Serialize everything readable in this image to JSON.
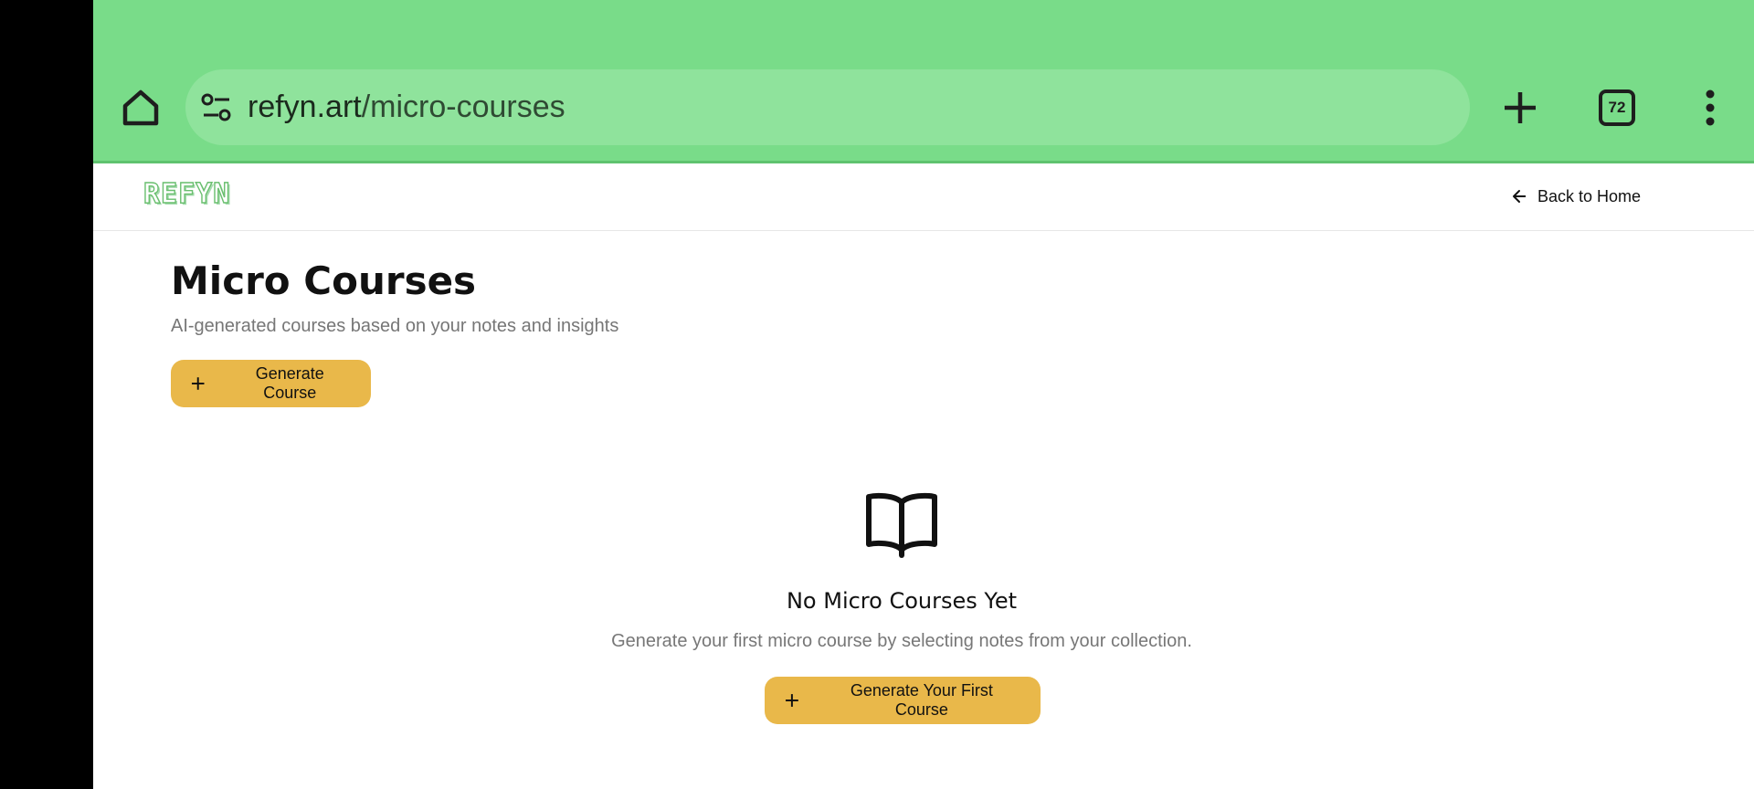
{
  "browser": {
    "url_domain": "refyn.art",
    "url_path": "/micro-courses",
    "tab_count": "72",
    "chrome_color": "#79dc89"
  },
  "header": {
    "logo_text": "REFYN",
    "back_label": "Back to Home"
  },
  "main": {
    "title": "Micro Courses",
    "subtitle": "AI-generated courses based on your notes and insights",
    "generate_button_label": "Generate Course",
    "accent_color": "#e9b84a"
  },
  "empty_state": {
    "icon": "book-open-icon",
    "title": "No Micro Courses Yet",
    "description": "Generate your first micro course by selecting notes from your collection.",
    "button_label": "Generate Your First Course"
  }
}
